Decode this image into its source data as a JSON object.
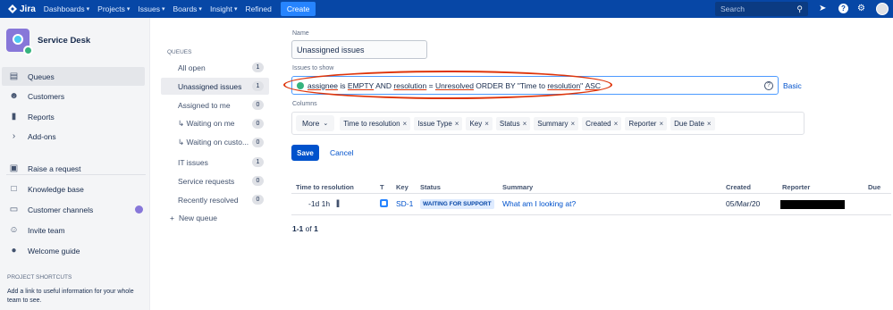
{
  "topnav": {
    "logo": "Jira",
    "menus": [
      "Dashboards",
      "Projects",
      "Issues",
      "Boards",
      "Insight"
    ],
    "refined": "Refined",
    "create": "Create",
    "search_placeholder": "Search"
  },
  "sidebar": {
    "project_name": "Service Desk",
    "items": [
      {
        "label": "Queues",
        "icon": "queues-icon"
      },
      {
        "label": "Customers",
        "icon": "customers-icon"
      },
      {
        "label": "Reports",
        "icon": "reports-icon"
      },
      {
        "label": "Add-ons",
        "icon": "chevron-right-icon"
      },
      {
        "label": "Raise a request",
        "icon": "raise-request-icon"
      },
      {
        "label": "Knowledge base",
        "icon": "knowledge-base-icon"
      },
      {
        "label": "Customer channels",
        "icon": "customer-channels-icon"
      },
      {
        "label": "Invite team",
        "icon": "invite-team-icon"
      },
      {
        "label": "Welcome guide",
        "icon": "welcome-guide-icon"
      }
    ],
    "shortcuts_title": "PROJECT SHORTCUTS",
    "shortcuts_text": "Add a link to useful information for your whole team to see."
  },
  "queues": {
    "title": "QUEUES",
    "items": [
      {
        "label": "All open",
        "count": "1"
      },
      {
        "label": "Unassigned issues",
        "count": "1"
      },
      {
        "label": "Assigned to me",
        "count": "0"
      },
      {
        "label": "↳ Waiting on me",
        "count": "0"
      },
      {
        "label": "↳ Waiting on custo...",
        "count": "0"
      },
      {
        "label": "IT issues",
        "count": "1"
      },
      {
        "label": "Service requests",
        "count": "0"
      },
      {
        "label": "Recently resolved",
        "count": "0"
      }
    ],
    "new_queue": "New queue"
  },
  "form": {
    "name_label": "Name",
    "name_value": "Unassigned issues",
    "issues_label": "Issues to show",
    "jql": {
      "p1": "assignee",
      "p2": " is ",
      "p3": "EMPTY",
      "p4": " AND ",
      "p5": "resolution",
      "p6": " = ",
      "p7": "Unresolved",
      "p8": " ORDER BY \"Time to ",
      "p9": "resolution",
      "p10": "\" ",
      "p11": "ASC"
    },
    "help_glyph": "?",
    "basic": "Basic",
    "columns_label": "Columns",
    "more": "More",
    "columns": [
      "Time to resolution",
      "Issue Type",
      "Key",
      "Status",
      "Summary",
      "Created",
      "Reporter",
      "Due Date"
    ],
    "save": "Save",
    "cancel": "Cancel"
  },
  "table": {
    "headers": [
      "Time to resolution",
      "T",
      "Key",
      "Status",
      "Summary",
      "Created",
      "Reporter",
      "Due"
    ],
    "row": {
      "time": "-1d 1h",
      "pause": "||",
      "key": "SD-1",
      "status": "WAITING FOR SUPPORT",
      "summary": "What am I looking at?",
      "created": "05/Mar/20"
    },
    "pagination": {
      "prefix": "1-1",
      "of": "of",
      "total": "1"
    }
  },
  "colors": {
    "nav": "#0747a6",
    "accent": "#0052cc",
    "annotation": "#de350b"
  }
}
